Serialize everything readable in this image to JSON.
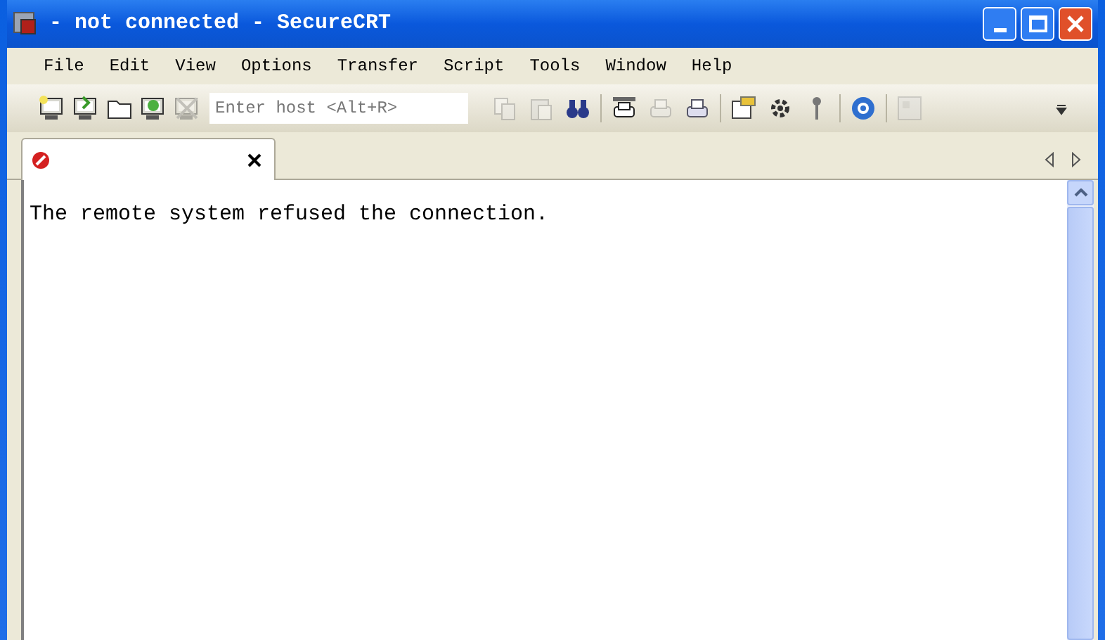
{
  "window": {
    "title": "- not connected - SecureCRT"
  },
  "menu": [
    "File",
    "Edit",
    "View",
    "Options",
    "Transfer",
    "Script",
    "Tools",
    "Window",
    "Help"
  ],
  "toolbar": {
    "host_field": {
      "placeholder": "Enter host <Alt+R>"
    }
  },
  "tabs": [
    {
      "selected": true,
      "failed": true
    }
  ],
  "terminal": {
    "lines": [
      "The remote system refused the connection."
    ]
  }
}
